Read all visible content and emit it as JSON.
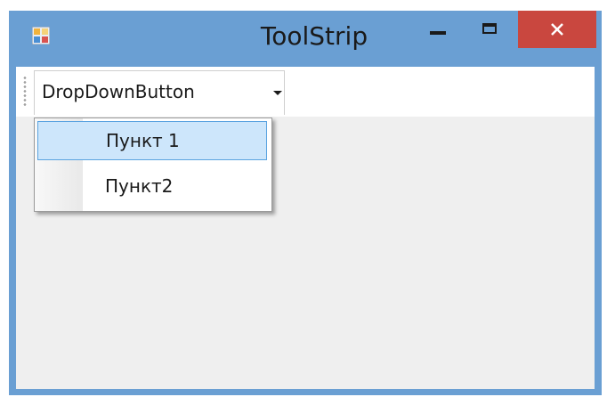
{
  "window": {
    "title": "ToolStrip",
    "icons": {
      "app": "app-window-icon",
      "minimize": "minimize-icon",
      "maximize": "maximize-icon",
      "close": "close-icon"
    },
    "colors": {
      "frame": "#6a9fd3",
      "close_button": "#c9473f",
      "client": "#efefef",
      "highlight_fill": "#cde6fb",
      "highlight_border": "#5aa3e0"
    }
  },
  "toolstrip": {
    "dropdown_button": {
      "label": "DropDownButton",
      "icon": "chevron-down-icon"
    }
  },
  "dropdown_menu": {
    "items": [
      {
        "label": "Пункт 1",
        "highlighted": true
      },
      {
        "label": "Пункт2",
        "highlighted": false
      }
    ]
  }
}
